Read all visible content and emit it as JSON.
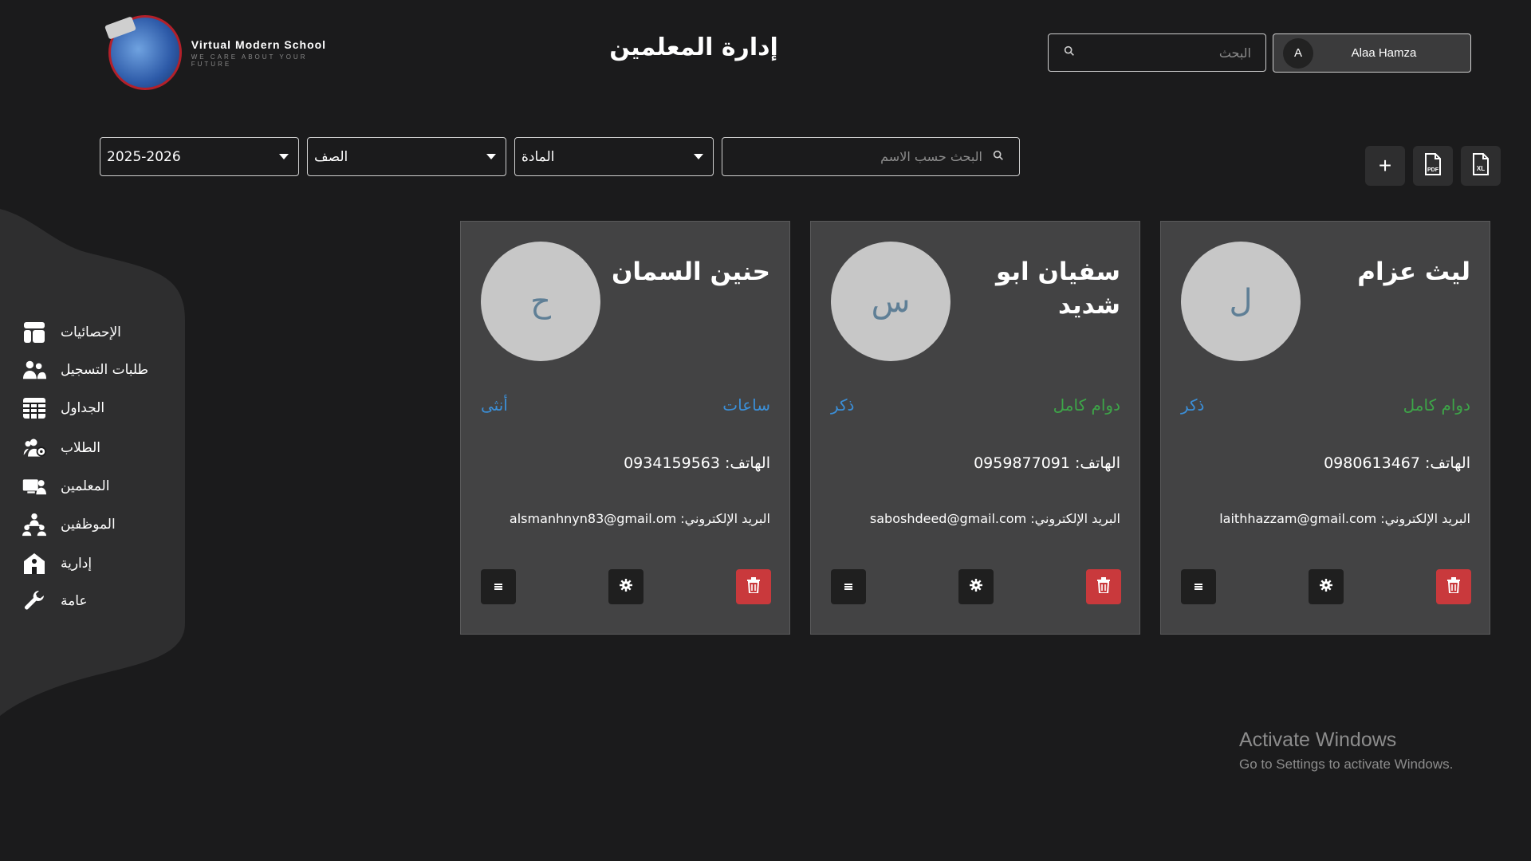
{
  "brand": {
    "title": "Virtual Modern School",
    "tagline": "WE CARE ABOUT YOUR FUTURE"
  },
  "header": {
    "page_title": "إدارة المعلمين",
    "search_placeholder": "البحث",
    "user": {
      "initial": "A",
      "name": "Alaa Hamza"
    }
  },
  "filters": {
    "year": "2025-2026",
    "class": "الصف",
    "subject": "المادة",
    "name_search_placeholder": "البحث حسب الاسم"
  },
  "toolbar": {
    "add": "+",
    "pdf_icon": "pdf-file-icon",
    "excel_icon": "excel-file-icon"
  },
  "sidebar": {
    "items": [
      {
        "label": "الإحصائيات",
        "icon": "dashboard-icon"
      },
      {
        "label": "طلبات التسجيل",
        "icon": "registration-icon"
      },
      {
        "label": "الجداول",
        "icon": "table-icon"
      },
      {
        "label": "الطلاب",
        "icon": "students-icon"
      },
      {
        "label": "المعلمين",
        "icon": "teachers-icon"
      },
      {
        "label": "الموظفين",
        "icon": "employees-icon"
      },
      {
        "label": "إدارية",
        "icon": "school-icon"
      },
      {
        "label": "عامة",
        "icon": "wrench-icon"
      }
    ]
  },
  "teachers": [
    {
      "name": "ليث عزام",
      "initial": "ل",
      "work_type": "دوام كامل",
      "gender": "ذكر",
      "phone": "الهاتف: 0980613467",
      "email": "البريد الإلكتروني: laithhazzam@gmail.com"
    },
    {
      "name": "سفيان ابو شديد",
      "initial": "س",
      "work_type": "دوام كامل",
      "gender": "ذكر",
      "phone": "الهاتف: 0959877091",
      "email": "البريد الإلكتروني: saboshdeed@gmail.com"
    },
    {
      "name": "حنين السمان",
      "initial": "ح",
      "work_type": "ساعات",
      "gender": "أنثى",
      "phone": "الهاتف: 0934159563",
      "email": "البريد الإلكتروني: alsmanhnyn83@gmail.om"
    }
  ],
  "watermark": {
    "line1": "Activate Windows",
    "line2": "Go to Settings to activate Windows."
  },
  "colors": {
    "background": "#1b1b1c",
    "card": "#434344",
    "accent_green": "#3da548",
    "accent_blue": "#3b8fd8",
    "delete_red": "#c9393c"
  }
}
